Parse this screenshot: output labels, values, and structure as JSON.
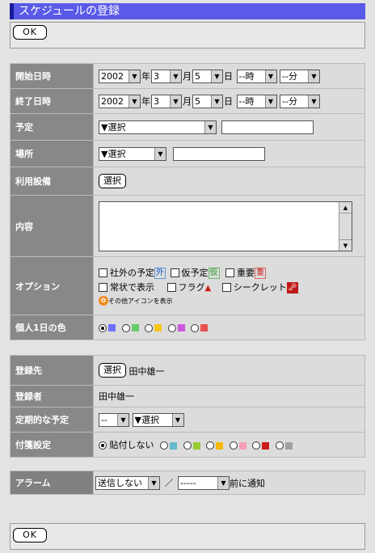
{
  "title": "スケジュールの登録",
  "ok_label": "OK",
  "labels": {
    "start": "開始日時",
    "end": "終了日時",
    "plan": "予定",
    "place": "場所",
    "equipment": "利用設備",
    "content": "内容",
    "option": "オプション",
    "color": "個人1日の色",
    "register_to": "登録先",
    "registrant": "登録者",
    "repeat": "定期的な予定",
    "sticky": "付箋設定",
    "alarm": "アラーム"
  },
  "units": {
    "year": "年",
    "month": "月",
    "day": "日"
  },
  "start": {
    "year": "2002",
    "month": "3",
    "day": "5",
    "hour": "--時",
    "min": "--分"
  },
  "end": {
    "year": "2002",
    "month": "3",
    "day": "5",
    "hour": "--時",
    "min": "--分"
  },
  "plan_select": "▼選択",
  "place_select": "▼選択",
  "select_button": "選択",
  "options": {
    "outside": "社外の予定",
    "outside_icon": "外",
    "tentative": "仮予定",
    "tentative_icon": "仮",
    "important": "重要",
    "important_icon": "重",
    "always_show": "常状で表示",
    "flag": "フラグ",
    "secret": "シークレット",
    "other_icons": "その他アイコンを表示"
  },
  "colors": [
    "#6e6efa",
    "#66cc66",
    "#f5c518",
    "#cc55dd",
    "#e85050"
  ],
  "user_name": "田中雄一",
  "repeat_select1": "--",
  "repeat_select2": "▼選択",
  "sticky_none": "貼付しない",
  "sticky_colors": [
    "#66b8cc",
    "#99cc33",
    "#f5b800",
    "#f5a0b4",
    "#cc1a1a",
    "#a0a0a0"
  ],
  "alarm_select1": "送信しない",
  "alarm_sep": "／",
  "alarm_select2": "-----",
  "alarm_suffix": "前に通知"
}
